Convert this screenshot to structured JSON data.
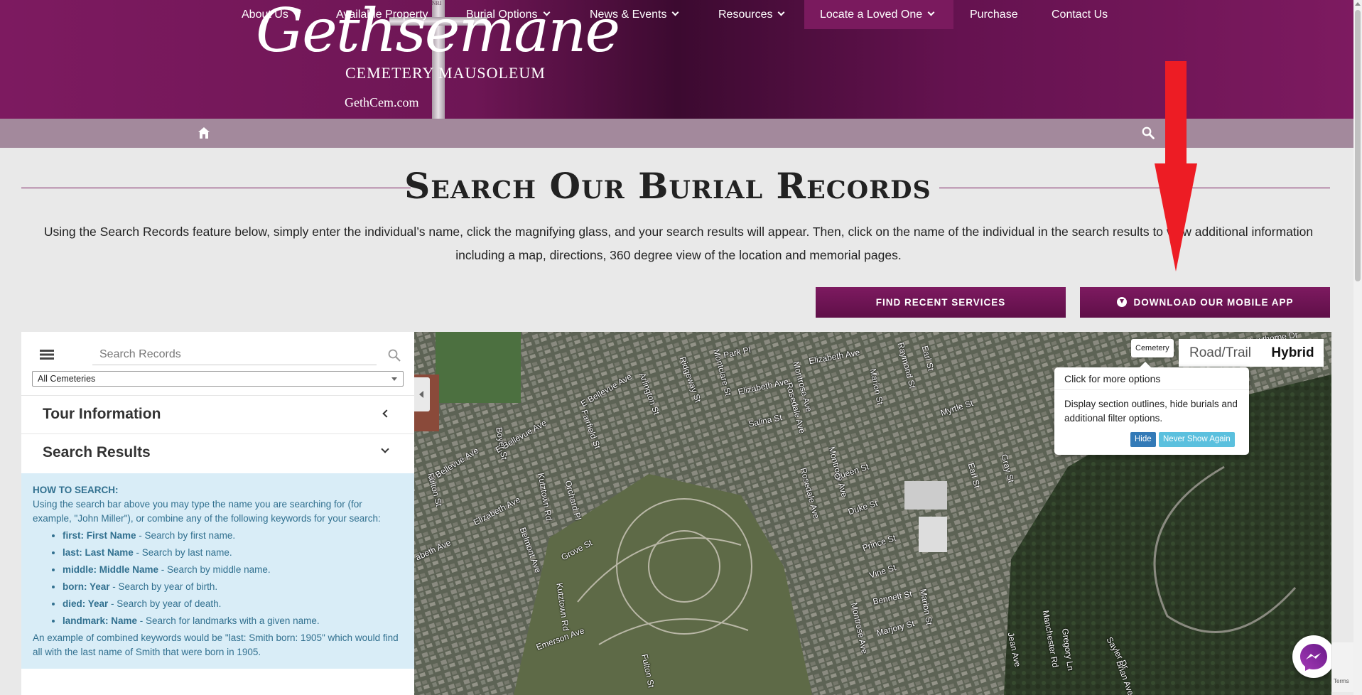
{
  "header": {
    "logo_script": "Gethsemane",
    "logo_subtitle": "CEMETERY MAUSOLEUM",
    "logo_url": "GethCem.com",
    "cross_inscription": "INRI"
  },
  "nav": {
    "items": [
      {
        "label": "About Us"
      },
      {
        "label": "Available Property"
      },
      {
        "label": "Burial Options"
      },
      {
        "label": "News & Events"
      },
      {
        "label": "Resources"
      },
      {
        "label": "Locate a Loved One"
      },
      {
        "label": "Purchase"
      },
      {
        "label": "Contact Us"
      }
    ],
    "home_icon": "home-icon",
    "search_icon": "search-icon"
  },
  "page": {
    "title": "Search Our Burial Records",
    "intro": "Using the Search Records feature below, simply enter the individual’s name, click the magnifying glass, and your search results will appear. Then, click on the name of the individual in the search results to view additional information including a map, directions, 360 degree view of the location and memorial pages."
  },
  "buttons": {
    "recent_services": "FIND RECENT SERVICES",
    "mobile_app": "DOWNLOAD OUR MOBILE APP"
  },
  "sidebar": {
    "search_placeholder": "Search Records",
    "cemetery_select": "All Cemeteries",
    "tour_title": "Tour Information",
    "results_title": "Search Results",
    "help": {
      "heading": "HOW TO SEARCH:",
      "intro": "Using the search bar above you may type the name you are searching for (for example, \"John Miller\"), or combine any of the following keywords for your search:",
      "keywords": [
        {
          "key": "first: First Name",
          "desc": " - Search by first name."
        },
        {
          "key": "last: Last Name",
          "desc": " - Search by last name."
        },
        {
          "key": "middle: Middle Name",
          "desc": " - Search by middle name."
        },
        {
          "key": "born: Year",
          "desc": " - Search by year of birth."
        },
        {
          "key": "died: Year",
          "desc": " - Search by year of death."
        },
        {
          "key": "landmark: Name",
          "desc": " - Search for landmarks with a given name."
        }
      ],
      "example": "An example of combined keywords would be \"last: Smith born: 1905\" which would find all with the last name of Smith that were born in 1905."
    }
  },
  "map": {
    "cemetery_chip": "Cemetery",
    "mode_road": "Road/Trail",
    "mode_hybrid": "Hybrid",
    "popover_title": "Click for more options",
    "popover_body": "Display section outlines, hide burials and additional filter options.",
    "popover_hide": "Hide",
    "popover_never": "Never Show Again",
    "recaptcha_terms": "Terms",
    "streets": {
      "s01": "E Bellevue Ave",
      "s02": "E Bellevue Ave",
      "s03": "E Bellevue Ave",
      "s04": "Elizabeth Ave",
      "s05": "Elizabeth Ave",
      "s06": "Elizabeth Ave",
      "s07": "abeth Ave",
      "s08": "Montclare St",
      "s09": "Montrose Ave",
      "s10": "Montrose Ave",
      "s11": "Montrose Ave",
      "s12": "Kutztown Rd",
      "s13": "Kutztown Rd",
      "s14": "Park Pl",
      "s15": "Salina St",
      "s16": "Rosedale Ave",
      "s17": "Rosedale Ave",
      "s18": "Queen St",
      "s19": "Duke St",
      "s20": "Prince St",
      "s21": "Vine St",
      "s22": "Bennett St",
      "s23": "Marjory St",
      "s24": "Marion St",
      "s25": "Marion St",
      "s26": "Myrtle St",
      "s27": "Grove St",
      "s28": "Belmont Ave",
      "s29": "Emerson Ave",
      "s30": "Fulton St",
      "s31": "Orchard Pl",
      "s32": "Fairfield St",
      "s33": "Arlington St",
      "s34": "Ridgeway St",
      "s35": "Raymond St",
      "s36": "Earl St",
      "s37": "Earl St",
      "s38": "Gray St",
      "s39": "Jean Ave",
      "s40": "Gregory Ln",
      "s41": "Manchester Rd",
      "s42": "Sayler Dr",
      "s43": "Brian Ave",
      "s44": "Hawthorne Dr",
      "s45": "Boyer St",
      "s46": "Fulton St"
    }
  },
  "colors": {
    "brand_purple": "#7a1a5e",
    "nav_bg": "#a3899c",
    "arrow_red": "#ed1c24",
    "help_bg": "#d9edf7",
    "help_text": "#31708f",
    "hide_btn": "#337ab7",
    "never_btn": "#5bc0de"
  }
}
